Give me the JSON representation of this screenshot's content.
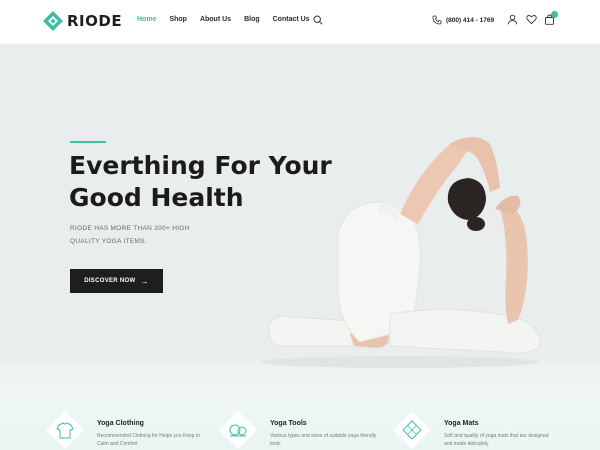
{
  "header": {
    "logo_text": "RIODE",
    "nav": [
      {
        "label": "Home",
        "active": true
      },
      {
        "label": "Shop",
        "active": false
      },
      {
        "label": "About Us",
        "active": false
      },
      {
        "label": "Blog",
        "active": false
      },
      {
        "label": "Contact Us",
        "active": false
      }
    ],
    "phone": "(800) 414 - 1769",
    "icons": [
      "search-icon",
      "phone-icon",
      "user-icon",
      "heart-icon",
      "cart-icon"
    ]
  },
  "hero": {
    "title_line1": "Everthing For Your",
    "title_line2": "Good Health",
    "subtitle_line1": "RIODE HAS MORE THAN 200+ HIGH",
    "subtitle_line2": "QUALITY YOGA ITEMS.",
    "button_label": "DISCOVER NOW",
    "button_arrow": "→"
  },
  "features": [
    {
      "title": "Yoga Clothing",
      "desc": "Recommended Clothing for Helps you Keep in Calm and Comfort",
      "icon": "shirt-icon"
    },
    {
      "title": "Yoga Tools",
      "desc": "Various types and sizes of suitable yoga friendly tools",
      "icon": "yoga-tools-icon"
    },
    {
      "title": "Yoga Mats",
      "desc": "Soft and quality of yoga mats that are designed and made delicately",
      "icon": "yoga-mat-icon"
    }
  ],
  "colors": {
    "accent": "#3dbea4",
    "dark": "#1e1e1e",
    "hero_bg": "#e9eded"
  }
}
